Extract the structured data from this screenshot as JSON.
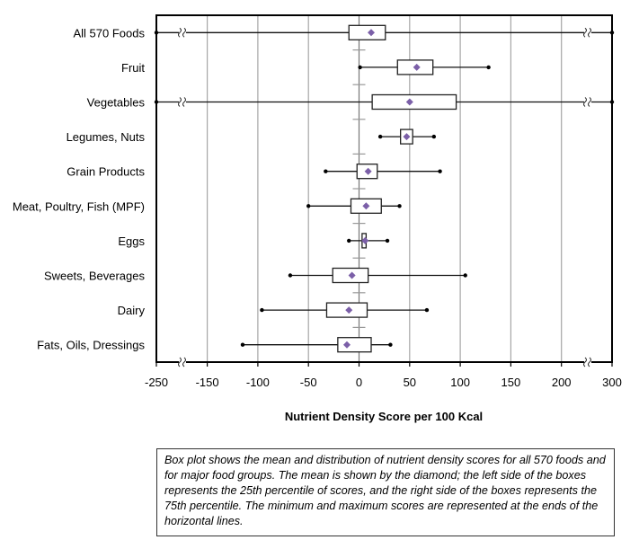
{
  "chart_data": {
    "type": "boxplot",
    "orientation": "horizontal",
    "title": "",
    "xlabel": "Nutrient Density Score per 100 Kcal",
    "ylabel": "",
    "xlim": [
      -250,
      300
    ],
    "x_ticks": [
      -250,
      -150,
      -100,
      -50,
      0,
      50,
      100,
      150,
      200,
      300
    ],
    "x_tick_labels": [
      "-250",
      "-150",
      "-100",
      "-50",
      "0",
      "50",
      "100",
      "150",
      "200",
      "300"
    ],
    "axis_breaks": [
      {
        "between": [
          -250,
          -150
        ]
      },
      {
        "between": [
          200,
          300
        ]
      }
    ],
    "grid": "vertical",
    "legend": "none",
    "mean_marker": "diamond",
    "mean_color": "#7b5fa8",
    "categories": [
      "All 570 Foods",
      "Fruit",
      "Vegetables",
      "Legumes, Nuts",
      "Grain Products",
      "Meat, Poultry, Fish (MPF)",
      "Eggs",
      "Sweets, Beverages",
      "Dairy",
      "Fats, Oils, Dressings"
    ],
    "series": [
      {
        "name": "All 570 Foods",
        "min": -250,
        "q1": -10,
        "mean": 12,
        "q3": 26,
        "max": 300,
        "min_beyond_break": true,
        "max_beyond_break": true
      },
      {
        "name": "Fruit",
        "min": 1,
        "q1": 38,
        "mean": 57,
        "q3": 73,
        "max": 128
      },
      {
        "name": "Vegetables",
        "min": -250,
        "q1": 13,
        "mean": 50,
        "q3": 96,
        "max": 300,
        "min_beyond_break": true,
        "max_beyond_break": true
      },
      {
        "name": "Legumes, Nuts",
        "min": 21,
        "q1": 41,
        "mean": 47,
        "q3": 53,
        "max": 74
      },
      {
        "name": "Grain Products",
        "min": -33,
        "q1": -2,
        "mean": 9,
        "q3": 18,
        "max": 80
      },
      {
        "name": "Meat, Poultry, Fish (MPF)",
        "min": -50,
        "q1": -8,
        "mean": 7,
        "q3": 22,
        "max": 40
      },
      {
        "name": "Eggs",
        "min": -10,
        "q1": 3,
        "mean": 6,
        "q3": 7,
        "max": 28
      },
      {
        "name": "Sweets, Beverages",
        "min": -68,
        "q1": -26,
        "mean": -7,
        "q3": 9,
        "max": 105
      },
      {
        "name": "Dairy",
        "min": -96,
        "q1": -32,
        "mean": -10,
        "q3": 8,
        "max": 67
      },
      {
        "name": "Fats, Oils, Dressings",
        "min": -115,
        "q1": -21,
        "mean": -12,
        "q3": 12,
        "max": 31
      }
    ]
  },
  "caption": "Box plot shows the mean and distribution of nutrient density scores for all 570 foods and for major food groups. The mean is shown by the diamond; the left side of the boxes represents the 25th percentile of scores, and the right side of the boxes represents the 75th percentile. The minimum and maximum scores are represented at the ends of the horizontal lines."
}
